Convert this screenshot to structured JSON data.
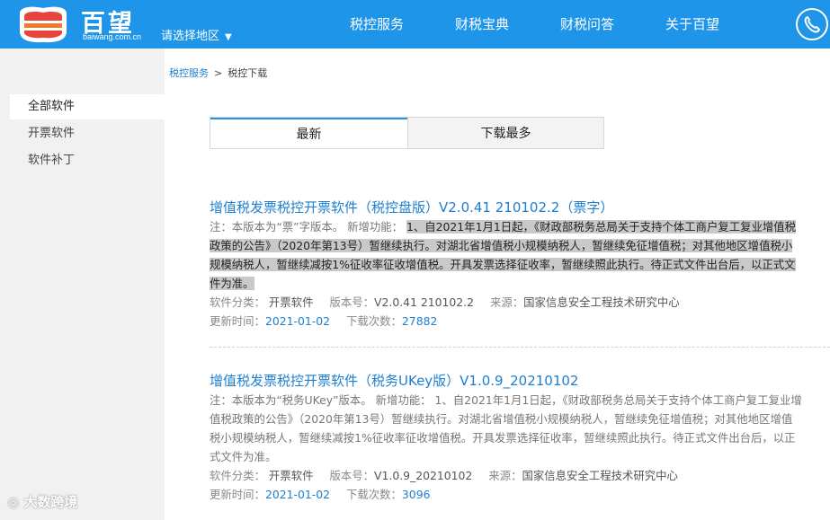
{
  "header": {
    "brand_name": "百望",
    "brand_domain": "baiwang.com.cn",
    "region_label": "请选择地区",
    "region_caret": "▼",
    "nav": [
      "税控服务",
      "财税宝典",
      "财税问答",
      "关于百望"
    ],
    "phone_icon": "phone-icon",
    "bg_color": "#1e95e8"
  },
  "sidebar": {
    "items": [
      "全部软件",
      "开票软件",
      "软件补丁"
    ],
    "active_index": 0
  },
  "breadcrumb": {
    "parent": "税控服务",
    "separator": ">",
    "current": "税控下载"
  },
  "tabs": {
    "latest": "最新",
    "most_downloaded": "下载最多",
    "active": "latest"
  },
  "entries": [
    {
      "title": "增值税发票税控开票软件（税控盘版）V2.0.41 210102.2（票字）",
      "note_prefix": "注：本版本为“票”字版本。 新增功能：",
      "note_highlight": "1、自2021年1月1日起，《财政部税务总局关于支持个体工商户复工复业增值税政策的公告》（2020年第13号）暂继续执行。对湖北省增值税小规模纳税人，暂继续免征增值税；对其他地区增值税小规模纳税人，暂继续减按1%征收率征收增值税。开具发票选择征收率，暂继续照此执行。待正式文件出台后，以正式文件为准。",
      "category_label": "软件分类：",
      "category": "开票软件",
      "version_label": "版本号：",
      "version": "V2.0.41 210102.2",
      "source_label": "来源：",
      "source": "国家信息安全工程技术研究中心",
      "updated_label": "更新时间：",
      "updated": "2021-01-02",
      "downloads_label": "下载次数：",
      "downloads": "27882"
    },
    {
      "title": "增值税发票税控开票软件（税务UKey版）V1.0.9_20210102",
      "note_prefix": "注：本版本为“税务UKey”版本。 新增功能：",
      "note_highlight": "1、自2021年1月1日起，《财政部税务总局关于支持个体工商户复工复业增值税政策的公告》（2020年第13号）暂继续执行。对湖北省增值税小规模纳税人，暂继续免征增值税；对其他地区增值税小规模纳税人，暂继续减按1%征收率征收增值税。开具发票选择征收率，暂继续照此执行。待正式文件出台后，以正式文件为准。",
      "category_label": "软件分类：",
      "category": "开票软件",
      "version_label": "版本号：",
      "version": "V1.0.9_20210102",
      "source_label": "来源：",
      "source": "国家信息安全工程技术研究中心",
      "updated_label": "更新时间：",
      "updated": "2021-01-02",
      "downloads_label": "下载次数：",
      "downloads": "3096"
    }
  ],
  "watermark": "大数跨境"
}
